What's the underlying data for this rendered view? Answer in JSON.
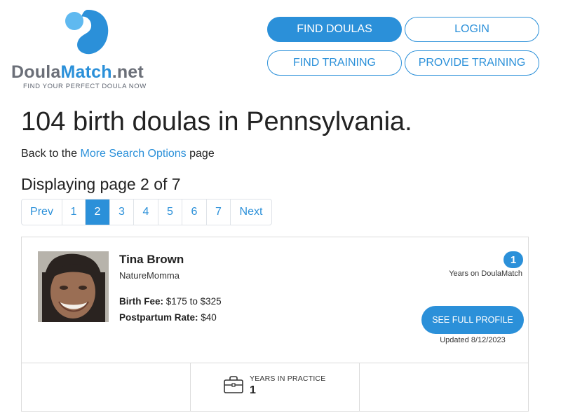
{
  "brand": {
    "name_part1": "Doula",
    "name_part2": "Match",
    "name_part3": ".net",
    "tagline": "FIND YOUR PERFECT DOULA NOW",
    "accent_color": "#2b90d9"
  },
  "nav": {
    "find_doulas": "FIND DOULAS",
    "login": "LOGIN",
    "find_training": "FIND TRAINING",
    "provide_training": "PROVIDE TRAINING"
  },
  "heading": "104 birth doulas in Pennsylvania.",
  "back": {
    "prefix": "Back to the ",
    "link": "More Search Options",
    "suffix": " page"
  },
  "pagination": {
    "status": "Displaying page 2 of 7",
    "prev": "Prev",
    "next": "Next",
    "pages": [
      "1",
      "2",
      "3",
      "4",
      "5",
      "6",
      "7"
    ],
    "current": "2"
  },
  "doula": {
    "name": "Tina Brown",
    "nickname": "NatureMomma",
    "birth_fee_label": "Birth Fee:",
    "birth_fee": "$175 to $325",
    "postpartum_label": "Postpartum Rate:",
    "postpartum_rate": "$40",
    "years_on_site": "1",
    "years_on_site_label": "Years on DoulaMatch",
    "profile_button": "SEE FULL PROFILE",
    "updated": "Updated 8/12/2023",
    "stats": [
      {
        "label": "YEARS IN PRACTICE",
        "value": "1",
        "icon": "briefcase-icon"
      }
    ]
  }
}
